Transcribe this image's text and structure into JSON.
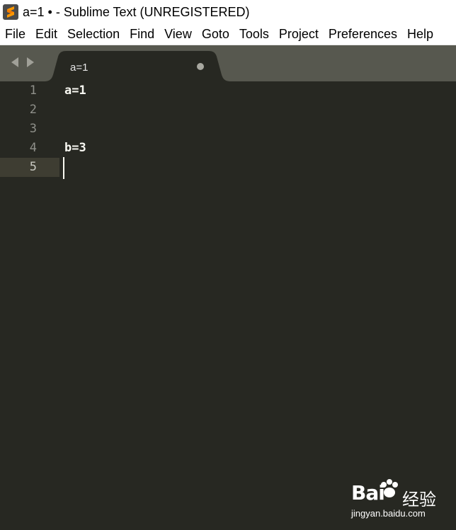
{
  "window": {
    "title": "a=1 • - Sublime Text (UNREGISTERED)",
    "app_icon": "sublime-text-icon"
  },
  "menu": {
    "items": [
      "File",
      "Edit",
      "Selection",
      "Find",
      "View",
      "Goto",
      "Tools",
      "Project",
      "Preferences",
      "Help"
    ]
  },
  "tabs": [
    {
      "label": "a=1",
      "dirty": true,
      "active": true
    }
  ],
  "editor": {
    "active_line": 5,
    "line_numbers": [
      "1",
      "2",
      "3",
      "4",
      "5"
    ],
    "lines": [
      "a=1",
      "",
      "",
      "b=3",
      ""
    ]
  },
  "watermark": {
    "logo_text": "Bai",
    "logo_suffix": "经验",
    "url": "jingyan.baidu.com"
  },
  "colors": {
    "editor_bg": "#272822",
    "tabbar_bg": "#57584f",
    "tab_active": "#272822",
    "text": "#f8f8f2",
    "gutter_text": "#8f908a",
    "active_line_bg": "#3e3d32"
  }
}
